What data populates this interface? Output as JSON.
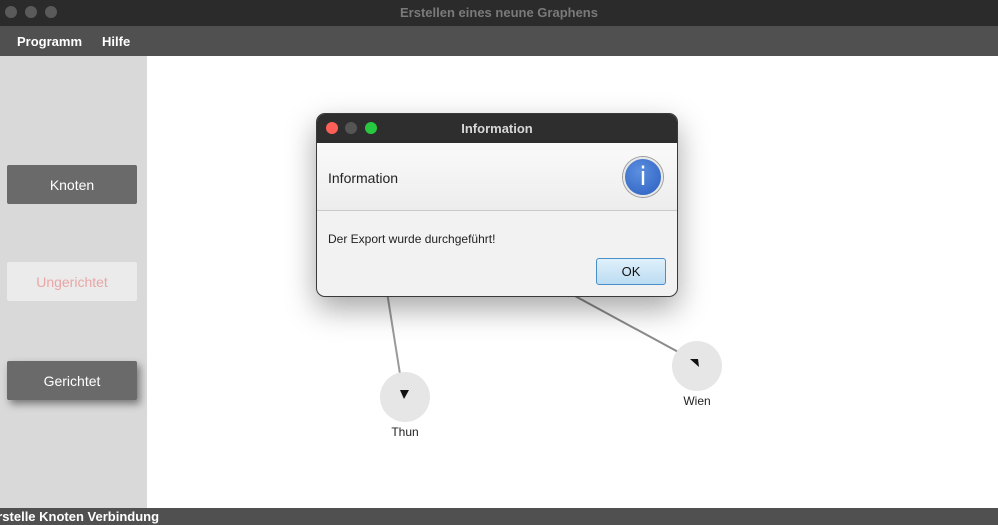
{
  "window": {
    "title": "Erstellen eines neune Graphens"
  },
  "menu": {
    "items": [
      {
        "label": "Programm"
      },
      {
        "label": "Hilfe"
      }
    ]
  },
  "sidebar": {
    "buttons": [
      {
        "label": "Knoten",
        "state": "normal"
      },
      {
        "label": "Ungerichtet",
        "state": "disabled"
      },
      {
        "label": "Gerichtet",
        "state": "hover"
      }
    ]
  },
  "graph": {
    "nodes": [
      {
        "label": "Thun"
      },
      {
        "label": "Wien"
      }
    ],
    "edges": [
      {
        "to": "Thun",
        "directed": true
      },
      {
        "to": "Wien",
        "directed": true
      }
    ]
  },
  "dialog": {
    "title": "Information",
    "header": "Information",
    "icon": "info-icon",
    "content": "Der Export wurde durchgeführt!",
    "ok_label": "OK"
  },
  "statusbar": {
    "text": "erstelle Knoten Verbindung"
  },
  "colors": {
    "accent": "#3a6fd0",
    "close": "#fe5f57",
    "minimize": "#5a5a5a",
    "zoom": "#28c840"
  }
}
